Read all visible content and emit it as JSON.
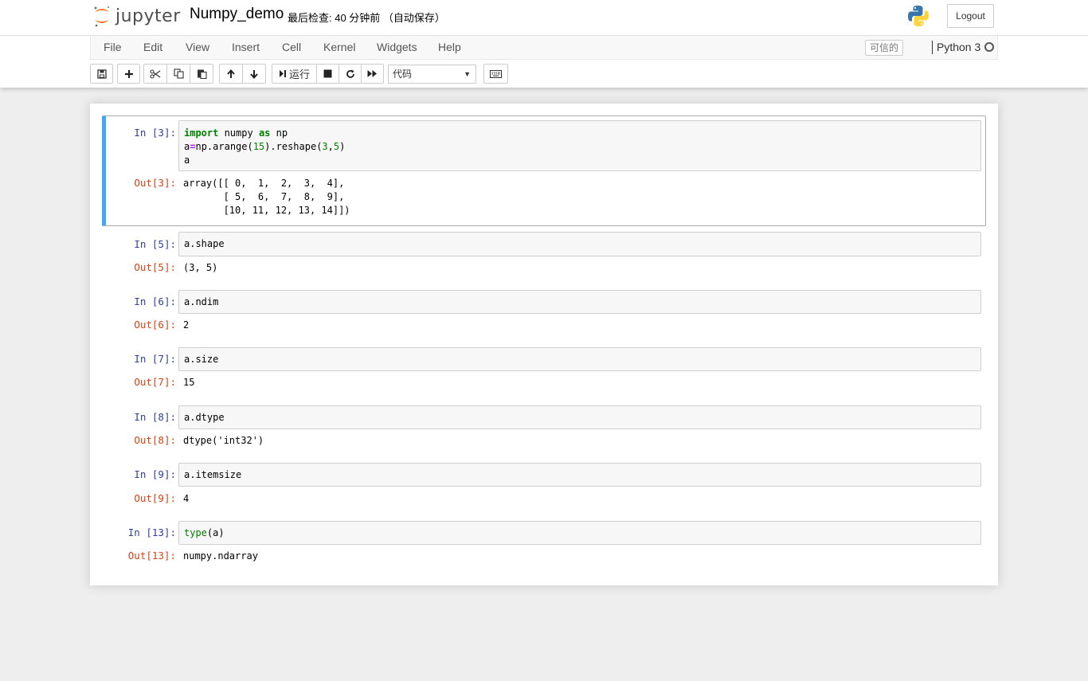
{
  "header": {
    "logo_text": "jupyter",
    "notebook_name": "Numpy_demo",
    "checkpoint": "最后检查: 40 分钟前 （自动保存）",
    "logout_label": "Logout"
  },
  "menubar": {
    "items": [
      "File",
      "Edit",
      "View",
      "Insert",
      "Cell",
      "Kernel",
      "Widgets",
      "Help"
    ],
    "trusted_label": "可信的",
    "kernel_name": "Python 3"
  },
  "toolbar": {
    "run_label": "运行",
    "cell_type": "代码"
  },
  "cells": [
    {
      "in_prompt": "In  [3]:",
      "code_lines": [
        "import numpy as np",
        "a=np.arange(15).reshape(3,5)",
        "a"
      ],
      "out_prompt": "Out[3]:",
      "output": "array([[ 0,  1,  2,  3,  4],\n       [ 5,  6,  7,  8,  9],\n       [10, 11, 12, 13, 14]])"
    },
    {
      "in_prompt": "In  [5]:",
      "code": "a.shape",
      "out_prompt": "Out[5]:",
      "output": "(3, 5)"
    },
    {
      "in_prompt": "In  [6]:",
      "code": "a.ndim",
      "out_prompt": "Out[6]:",
      "output": "2"
    },
    {
      "in_prompt": "In  [7]:",
      "code": "a.size",
      "out_prompt": "Out[7]:",
      "output": "15"
    },
    {
      "in_prompt": "In  [8]:",
      "code": "a.dtype",
      "out_prompt": "Out[8]:",
      "output": "dtype('int32')"
    },
    {
      "in_prompt": "In  [9]:",
      "code": "a.itemsize",
      "out_prompt": "Out[9]:",
      "output": "4"
    },
    {
      "in_prompt": "In  [13]:",
      "code_fn": "type",
      "code_rest": "(a)",
      "out_prompt": "Out[13]:",
      "output": "numpy.ndarray"
    }
  ],
  "colors": {
    "selected_border": "#42a5f5",
    "in_prompt": "#303f9f",
    "out_prompt": "#d84315",
    "keyword": "#008000"
  }
}
